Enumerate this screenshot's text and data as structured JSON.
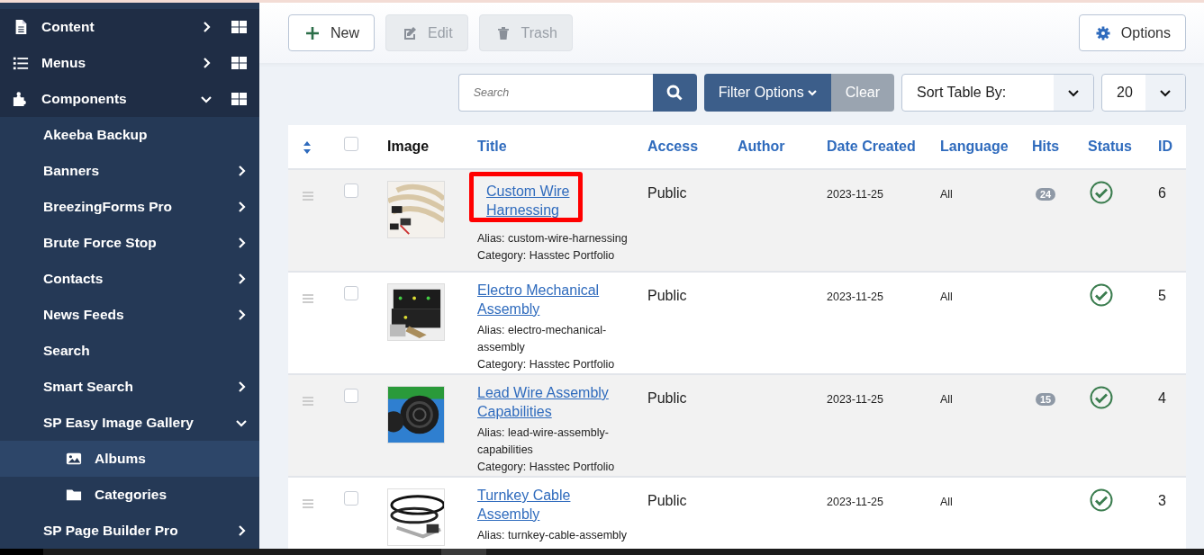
{
  "sidebar": {
    "items": [
      {
        "label": "Content",
        "expandable": true,
        "expanded": false,
        "selected": false
      },
      {
        "label": "Menus",
        "expandable": true,
        "expanded": false,
        "selected": false
      },
      {
        "label": "Components",
        "expandable": true,
        "expanded": true,
        "selected": false,
        "children": [
          {
            "label": "Akeeba Backup",
            "expandable": false,
            "expanded": false,
            "selected": false
          },
          {
            "label": "Banners",
            "expandable": true,
            "expanded": false,
            "selected": false
          },
          {
            "label": "BreezingForms Pro",
            "expandable": true,
            "expanded": false,
            "selected": false
          },
          {
            "label": "Brute Force Stop",
            "expandable": true,
            "expanded": false,
            "selected": false
          },
          {
            "label": "Contacts",
            "expandable": true,
            "expanded": false,
            "selected": false
          },
          {
            "label": "News Feeds",
            "expandable": true,
            "expanded": false,
            "selected": false
          },
          {
            "label": "Search",
            "expandable": false,
            "expanded": false,
            "selected": false
          },
          {
            "label": "Smart Search",
            "expandable": true,
            "expanded": false,
            "selected": false
          },
          {
            "label": "SP Easy Image Gallery",
            "expandable": true,
            "expanded": true,
            "selected": false,
            "children": [
              {
                "label": "Albums",
                "expandable": false,
                "expanded": false,
                "selected": true
              },
              {
                "label": "Categories",
                "expandable": false,
                "expanded": false,
                "selected": false
              }
            ]
          },
          {
            "label": "SP Page Builder Pro",
            "expandable": true,
            "expanded": false,
            "selected": false
          }
        ]
      }
    ]
  },
  "toolbar": {
    "buttons": [
      {
        "label": "New",
        "disabled": false
      },
      {
        "label": "Edit",
        "disabled": true
      },
      {
        "label": "Trash",
        "disabled": true
      }
    ],
    "options": {
      "label": "Options"
    }
  },
  "filters": {
    "search": {
      "placeholder": "Search"
    },
    "filter_button": "Filter Options",
    "clear_button": "Clear",
    "sort": {
      "value": "Sort Table By:"
    },
    "limit": {
      "value": "20"
    }
  },
  "table": {
    "select_all": {
      "checked": false
    },
    "columns": [
      {
        "label": "Image",
        "sortable": false
      },
      {
        "label": "Title",
        "sortable": true
      },
      {
        "label": "Access",
        "sortable": true
      },
      {
        "label": "Author",
        "sortable": true
      },
      {
        "label": "Date Created",
        "sortable": true
      },
      {
        "label": "Language",
        "sortable": true
      },
      {
        "label": "Hits",
        "sortable": true
      },
      {
        "label": "Status",
        "sortable": true
      },
      {
        "label": "ID",
        "sortable": true
      }
    ],
    "rows": [
      {
        "title": "Custom Wire Harnessing",
        "alias": "Alias: custom-wire-harnessing",
        "category": "Category: Hasstec Portfolio",
        "access": "Public",
        "date": "2023-11-25",
        "language": "All",
        "hits": "24",
        "published": true,
        "id": "6",
        "checked": false,
        "highlighted": true
      },
      {
        "title": "Electro Mechanical Assembly",
        "alias": "Alias: electro-mechanical-assembly",
        "category": "Category: Hasstec Portfolio",
        "access": "Public",
        "date": "2023-11-25",
        "language": "All",
        "published": true,
        "id": "5",
        "checked": false,
        "highlighted": false
      },
      {
        "title": "Lead Wire Assembly Capabilities",
        "alias": "Alias: lead-wire-assembly-capabilities",
        "category": "Category: Hasstec Portfolio",
        "access": "Public",
        "date": "2023-11-25",
        "language": "All",
        "hits": "15",
        "published": true,
        "id": "4",
        "checked": false,
        "highlighted": false
      },
      {
        "title": "Turnkey Cable Assembly",
        "alias": "Alias: turnkey-cable-assembly",
        "access": "Public",
        "date": "2023-11-25",
        "language": "All",
        "published": true,
        "id": "3",
        "checked": false,
        "highlighted": false
      }
    ]
  }
}
